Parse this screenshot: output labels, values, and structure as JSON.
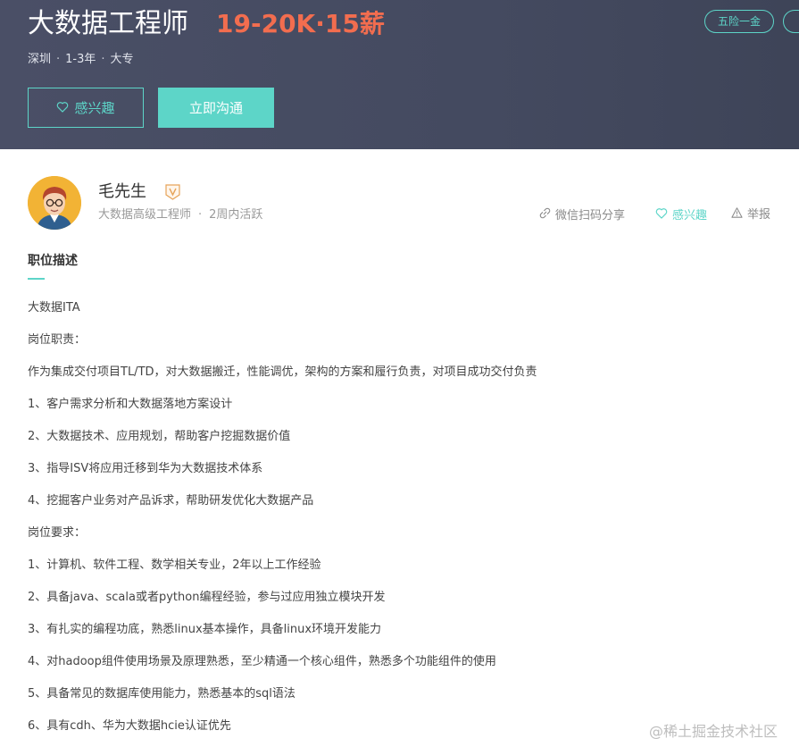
{
  "job": {
    "title": "大数据工程师",
    "salary": "19-20K·15薪",
    "city": "深圳",
    "experience": "1-3年",
    "education": "大专",
    "separator": "·",
    "tags": [
      "五险一金",
      ""
    ]
  },
  "buttons": {
    "interest": "感兴趣",
    "chat": "立即沟通"
  },
  "recruiter": {
    "name": "毛先生",
    "title": "大数据高级工程师",
    "separator": "·",
    "active": "2周内活跃"
  },
  "actions": {
    "share": "微信扫码分享",
    "like": "感兴趣",
    "report": "举报"
  },
  "section": {
    "title": "职位描述"
  },
  "description": [
    "大数据ITA",
    "岗位职责：",
    "作为集成交付项目TL/TD，对大数据搬迁，性能调优，架构的方案和履行负责，对项目成功交付负责",
    "1、客户需求分析和大数据落地方案设计",
    "2、大数据技术、应用规划，帮助客户挖掘数据价值",
    "3、指导ISV将应用迁移到华为大数据技术体系",
    "4、挖掘客户业务对产品诉求，帮助研发优化大数据产品",
    "岗位要求：",
    "1、计算机、软件工程、数学相关专业，2年以上工作经验",
    "2、具备java、scala或者python编程经验，参与过应用独立模块开发",
    "3、有扎实的编程功底，熟悉linux基本操作，具备linux环境开发能力",
    "4、对hadoop组件使用场景及原理熟悉，至少精通一个核心组件，熟悉多个功能组件的使用",
    "5、具备常见的数据库使用能力，熟悉基本的sql语法",
    "6、具有cdh、华为大数据hcie认证优先"
  ],
  "watermark": "@稀土掘金技术社区",
  "colors": {
    "accent": "#5dd5c8",
    "salary": "#f26d4f",
    "hero_bg": "#474c62"
  },
  "icons": {
    "interest": "heart-outline-icon",
    "share": "link-icon",
    "like": "heart-outline-icon",
    "report": "warning-triangle-icon",
    "verify": "verified-v-badge-icon"
  }
}
